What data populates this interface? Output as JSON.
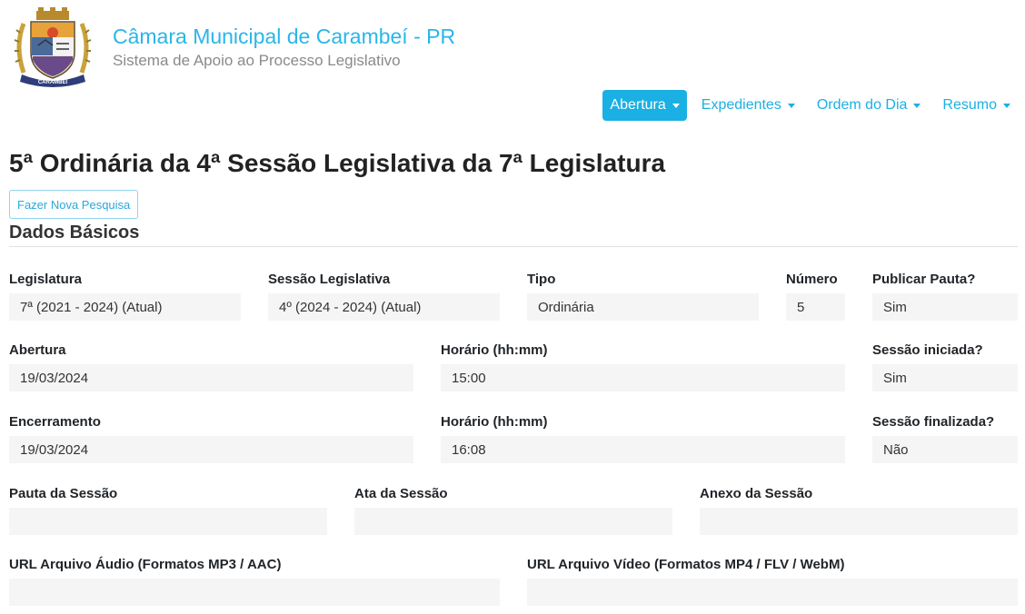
{
  "header": {
    "logo_label": "CARAMBEÍ",
    "title": "Câmara Municipal de Carambeí - PR",
    "subtitle": "Sistema de Apoio ao Processo Legislativo"
  },
  "nav": [
    {
      "label": "Abertura",
      "active": true
    },
    {
      "label": "Expedientes",
      "active": false
    },
    {
      "label": "Ordem do Dia",
      "active": false
    },
    {
      "label": "Resumo",
      "active": false
    }
  ],
  "page_title": "5ª Ordinária da 4ª Sessão Legislativa da 7ª Legislatura",
  "new_search_label": "Fazer Nova Pesquisa",
  "section_title": "Dados Básicos",
  "fields": {
    "legislatura": {
      "label": "Legislatura",
      "value": "7ª (2021 - 2024) (Atual)"
    },
    "sessao_legislativa": {
      "label": "Sessão Legislativa",
      "value": "4º (2024 - 2024) (Atual)"
    },
    "tipo": {
      "label": "Tipo",
      "value": "Ordinária"
    },
    "numero": {
      "label": "Número",
      "value": "5"
    },
    "publicar_pauta": {
      "label": "Publicar Pauta?",
      "value": "Sim"
    },
    "abertura": {
      "label": "Abertura",
      "value": "19/03/2024"
    },
    "horario_inicio": {
      "label": "Horário (hh:mm)",
      "value": "15:00"
    },
    "sessao_iniciada": {
      "label": "Sessão iniciada?",
      "value": "Sim"
    },
    "encerramento": {
      "label": "Encerramento",
      "value": "19/03/2024"
    },
    "horario_fim": {
      "label": "Horário (hh:mm)",
      "value": "16:08"
    },
    "sessao_finalizada": {
      "label": "Sessão finalizada?",
      "value": "Não"
    },
    "pauta": {
      "label": "Pauta da Sessão",
      "value": ""
    },
    "ata": {
      "label": "Ata da Sessão",
      "value": ""
    },
    "anexo": {
      "label": "Anexo da Sessão",
      "value": ""
    },
    "url_audio": {
      "label": "URL Arquivo Áudio (Formatos MP3 / AAC)",
      "value": ""
    },
    "url_video": {
      "label": "URL Arquivo Vídeo (Formatos MP4 / FLV / WebM)",
      "value": ""
    }
  }
}
